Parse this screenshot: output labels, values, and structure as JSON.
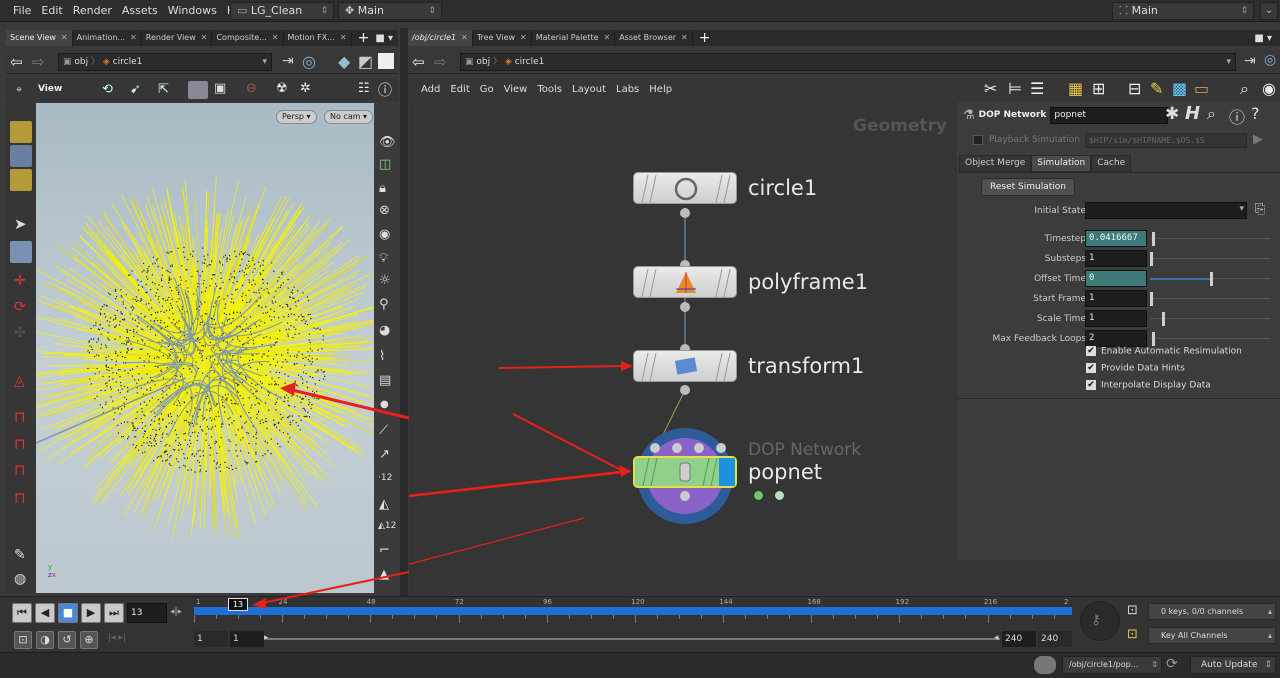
{
  "menubar": {
    "items": [
      "File",
      "Edit",
      "Render",
      "Assets",
      "Windows",
      "Help"
    ],
    "desktop": "LG_Clean",
    "context": "Main",
    "right_context": "Main"
  },
  "left_pane": {
    "tabs": [
      "Scene View",
      "Animation...",
      "Render View",
      "Composite...",
      "Motion FX..."
    ],
    "path": [
      "obj",
      "circle1"
    ],
    "view_label": "View",
    "persp_btn": "Persp",
    "cam_btn": "No cam",
    "axis_labels": [
      "y",
      "z",
      "x"
    ]
  },
  "right_pane": {
    "tabs": [
      "/obj/circle1",
      "Tree View",
      "Material Palette",
      "Asset Browser"
    ],
    "path": [
      "obj",
      "circle1"
    ],
    "menu": [
      "Add",
      "Edit",
      "Go",
      "View",
      "Tools",
      "Layout",
      "Labs",
      "Help"
    ],
    "context_title": "Geometry",
    "nodes": [
      {
        "name": "circle1"
      },
      {
        "name": "polyframe1"
      },
      {
        "name": "transform1"
      },
      {
        "name": "popnet",
        "type_label": "DOP Network"
      }
    ]
  },
  "params": {
    "node_type": "DOP Network",
    "node_name": "popnet",
    "playback_label": "Playback Simulation",
    "playback_path": "$HIP/sim/$HIPNAME.$OS.$S",
    "tabs": [
      "Object Merge",
      "Simulation",
      "Cache"
    ],
    "reset_button": "Reset Simulation",
    "rows": [
      {
        "label": "Initial State",
        "value": ""
      },
      {
        "label": "Timestep",
        "value": "0.0416667",
        "knob": 0.02
      },
      {
        "label": "Substeps",
        "value": "1",
        "knob": 0.0
      },
      {
        "label": "Offset Time",
        "value": "0",
        "knob": 0.5
      },
      {
        "label": "Start Frame",
        "value": "1",
        "knob": 0.0
      },
      {
        "label": "Scale Time",
        "value": "1",
        "knob": 0.1
      },
      {
        "label": "Max Feedback Loops",
        "value": "2",
        "knob": 0.02
      }
    ],
    "checks": [
      "Enable Automatic Resimulation",
      "Provide Data Hints",
      "Interpolate Display Data"
    ]
  },
  "timeline": {
    "current_frame": "13",
    "frame_marker": "13",
    "ticks": [
      "1",
      "24",
      "48",
      "72",
      "96",
      "120",
      "144",
      "168",
      "192",
      "216",
      "2"
    ],
    "range_start": "1",
    "range_start2": "1",
    "range_end": "240",
    "range_end2": "240",
    "keys_info": "0 keys, 0/0 channels",
    "key_all": "Key All Channels"
  },
  "status": {
    "path": "/obj/circle1/pop...",
    "update_mode": "Auto Update"
  },
  "colors": {
    "accent_blue": "#1a6fd0",
    "node_green": "#8fd18a",
    "annotation_red": "#e8201a"
  }
}
